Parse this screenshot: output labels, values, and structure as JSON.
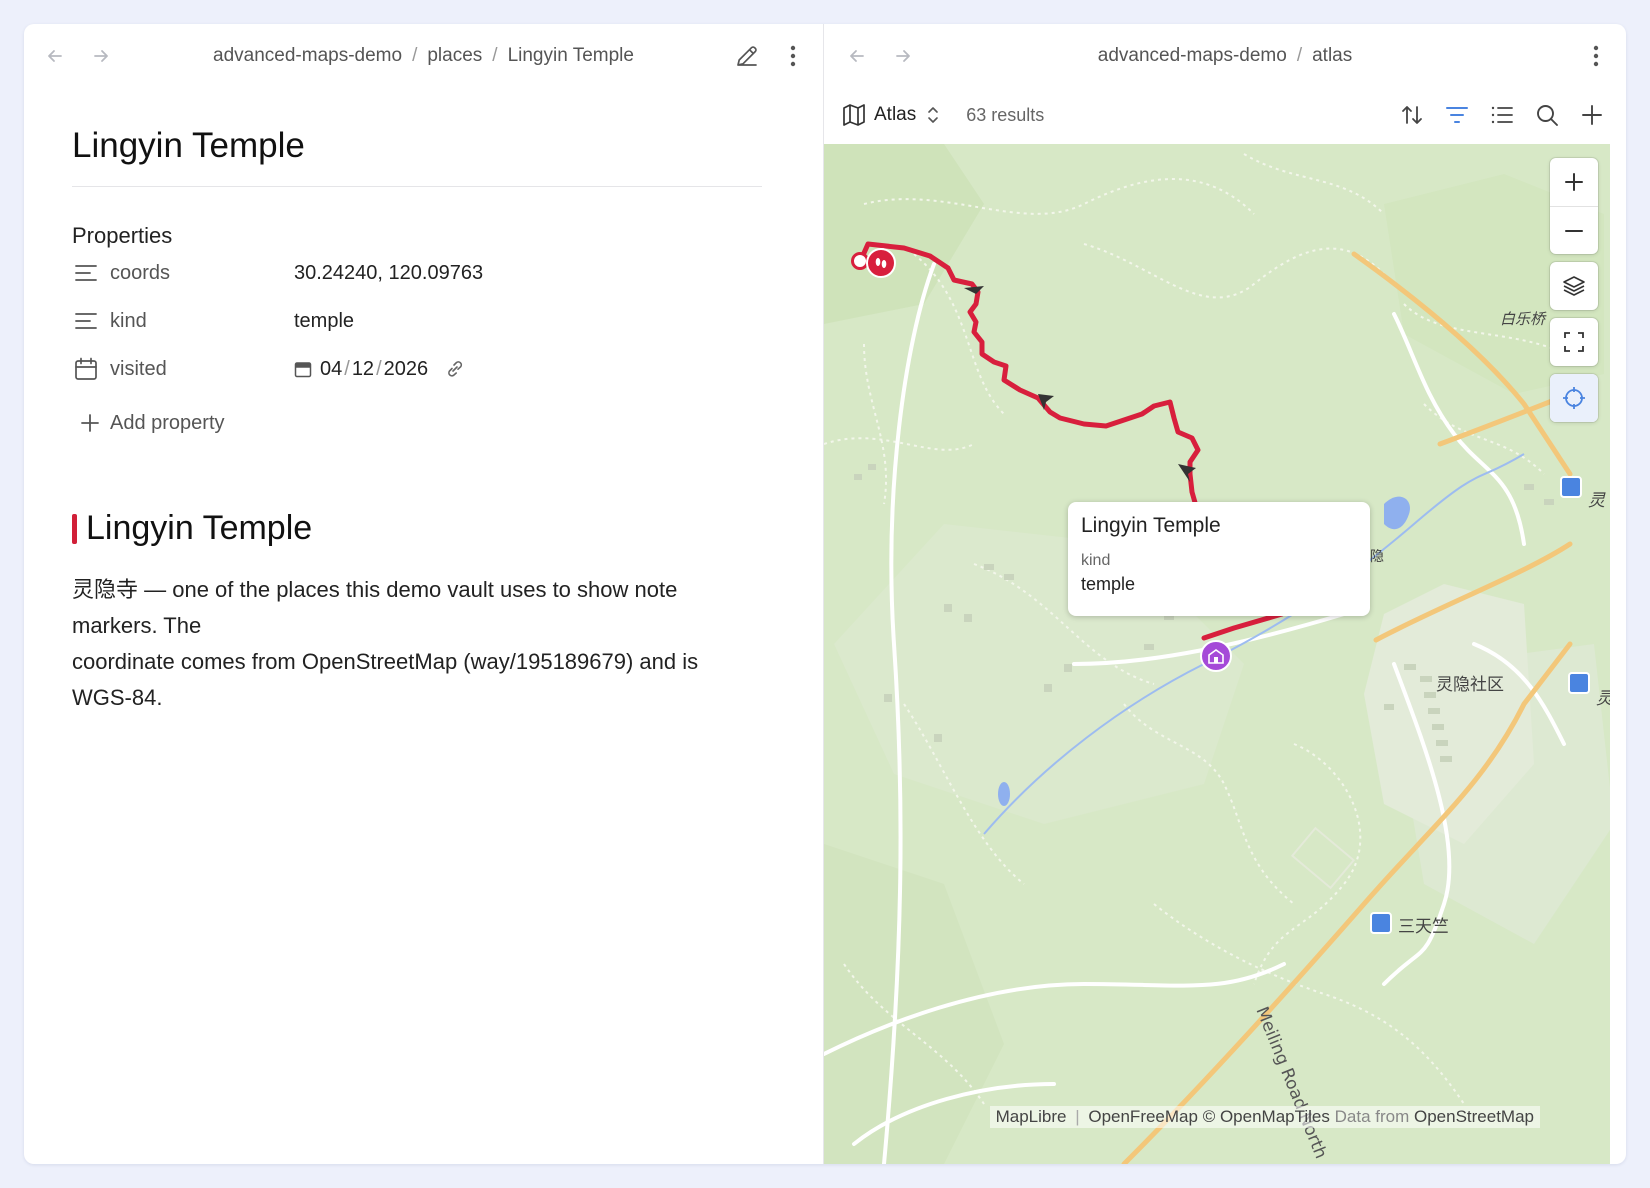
{
  "left": {
    "breadcrumb": [
      "advanced-maps-demo",
      "places",
      "Lingyin Temple"
    ],
    "title": "Lingyin Temple",
    "properties_heading": "Properties",
    "properties": [
      {
        "key": "coords",
        "value": "30.24240, 120.09763",
        "icon": "text-lines-icon"
      },
      {
        "key": "kind",
        "value": "temple",
        "icon": "text-lines-icon"
      },
      {
        "key": "visited",
        "date_month": "04",
        "date_day": "12",
        "date_year": "2026",
        "icon": "calendar-icon"
      }
    ],
    "add_property_label": "Add property",
    "heading": "Lingyin Temple",
    "body_text": "灵隐寺 — one of the places this demo vault uses to show note markers. The\ncoordinate comes from OpenStreetMap (way/195189679) and is WGS-84."
  },
  "right": {
    "breadcrumb": [
      "advanced-maps-demo",
      "atlas"
    ],
    "view_name": "Atlas",
    "result_count": "63 results",
    "popup": {
      "title": "Lingyin Temple",
      "key": "kind",
      "value": "temple"
    },
    "attribution": {
      "maplibre": "MapLibre",
      "openfreemap": "OpenFreeMap",
      "openmaptiles": "© OpenMapTiles",
      "data_from": "Data from",
      "osm": "OpenStreetMap"
    },
    "map_labels": {
      "bailejiao": "白乐桥",
      "lingyin_community": "灵隐社区",
      "santianzhu": "三天竺",
      "meiling_road": "Meiling Road North",
      "ling_partial_1": "灵",
      "ling_partial_2": "灵",
      "yin_partial": "隐"
    },
    "colors": {
      "route": "#d81f3d",
      "temple_marker": "#a54ad8",
      "start_marker": "#d81f3d",
      "accent": "#4a84e0"
    }
  }
}
